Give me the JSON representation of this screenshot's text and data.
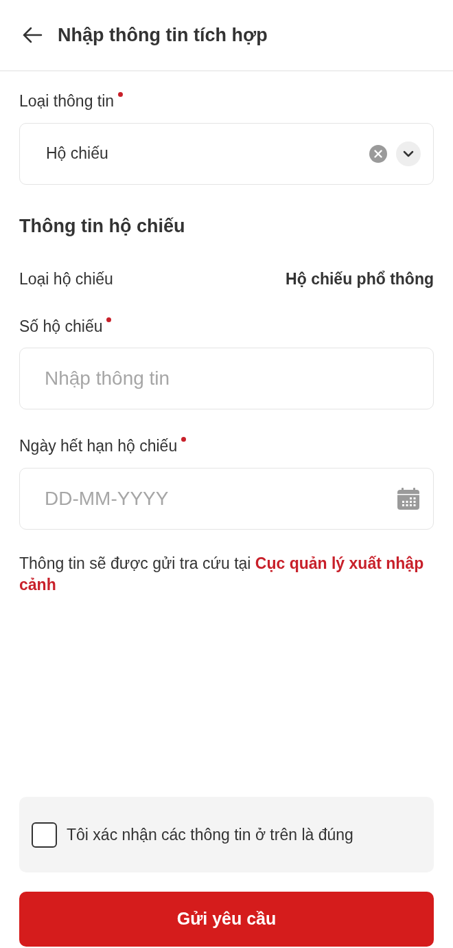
{
  "header": {
    "title": "Nhập thông tin tích hợp"
  },
  "info_type": {
    "label": "Loại thông tin",
    "required": true,
    "value": "Hộ chiếu"
  },
  "section_title": "Thông tin hộ chiếu",
  "passport_type": {
    "label": "Loại hộ chiếu",
    "value": "Hộ chiếu phổ thông"
  },
  "fields": [
    {
      "kind": "text",
      "label": "Số hộ chiếu",
      "required": true,
      "placeholder": "Nhập thông tin"
    },
    {
      "kind": "date",
      "label": "Ngày hết hạn hộ chiếu",
      "required": true,
      "placeholder": "DD-MM-YYYY"
    }
  ],
  "note": "Thông tin sẽ được gửi tra cứu tại **Cục quản lý xuất nhập cảnh**",
  "confirm": {
    "label": "Tôi xác nhận các thông tin ở trên là đúng",
    "checked": false
  },
  "submit": "Gửi yêu cầu"
}
